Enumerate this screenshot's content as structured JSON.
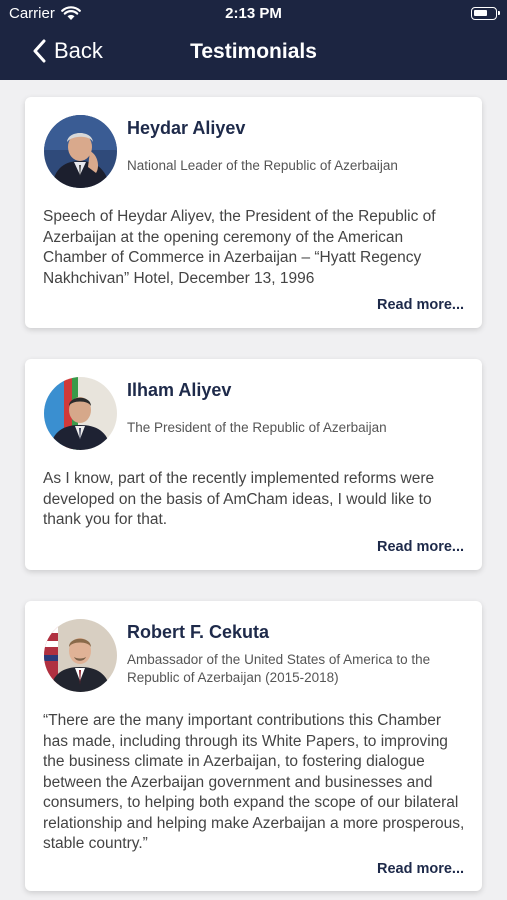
{
  "status_bar": {
    "carrier": "Carrier",
    "time": "2:13 PM"
  },
  "nav": {
    "back_label": "Back",
    "title": "Testimonials"
  },
  "testimonials": [
    {
      "name": "Heydar Aliyev",
      "role": "National Leader of the Republic of Azerbaijan",
      "quote": "Speech of Heydar Aliyev, the President of the Republic of Azerbaijan at the opening ceremony of the American Chamber of Commerce in Azerbaijan – “Hyatt Regency Nakhchivan” Hotel, December 13, 1996",
      "read_more": "Read more..."
    },
    {
      "name": "Ilham Aliyev",
      "role": "The President of the Republic of Azerbaijan",
      "quote": "As I know, part of the recently implemented reforms were developed on the basis of AmCham ideas, I would like to thank you for that.",
      "read_more": "Read more..."
    },
    {
      "name": "Robert F. Cekuta",
      "role": "Ambassador of the United States of America to the Republic of Azerbaijan (2015-2018)",
      "quote": "“There are the many important contributions this Chamber has made, including through its White Papers, to improving the business climate in Azerbaijan, to fostering dialogue between the Azerbaijan government and businesses and consumers, to helping both expand the scope of our bilateral relationship and helping make Azerbaijan a more prosperous, stable country.”",
      "read_more": "Read more..."
    }
  ],
  "colors": {
    "nav_bg": "#1c2541",
    "accent": "#1e2a4a",
    "page_bg": "#f0f0f2"
  }
}
